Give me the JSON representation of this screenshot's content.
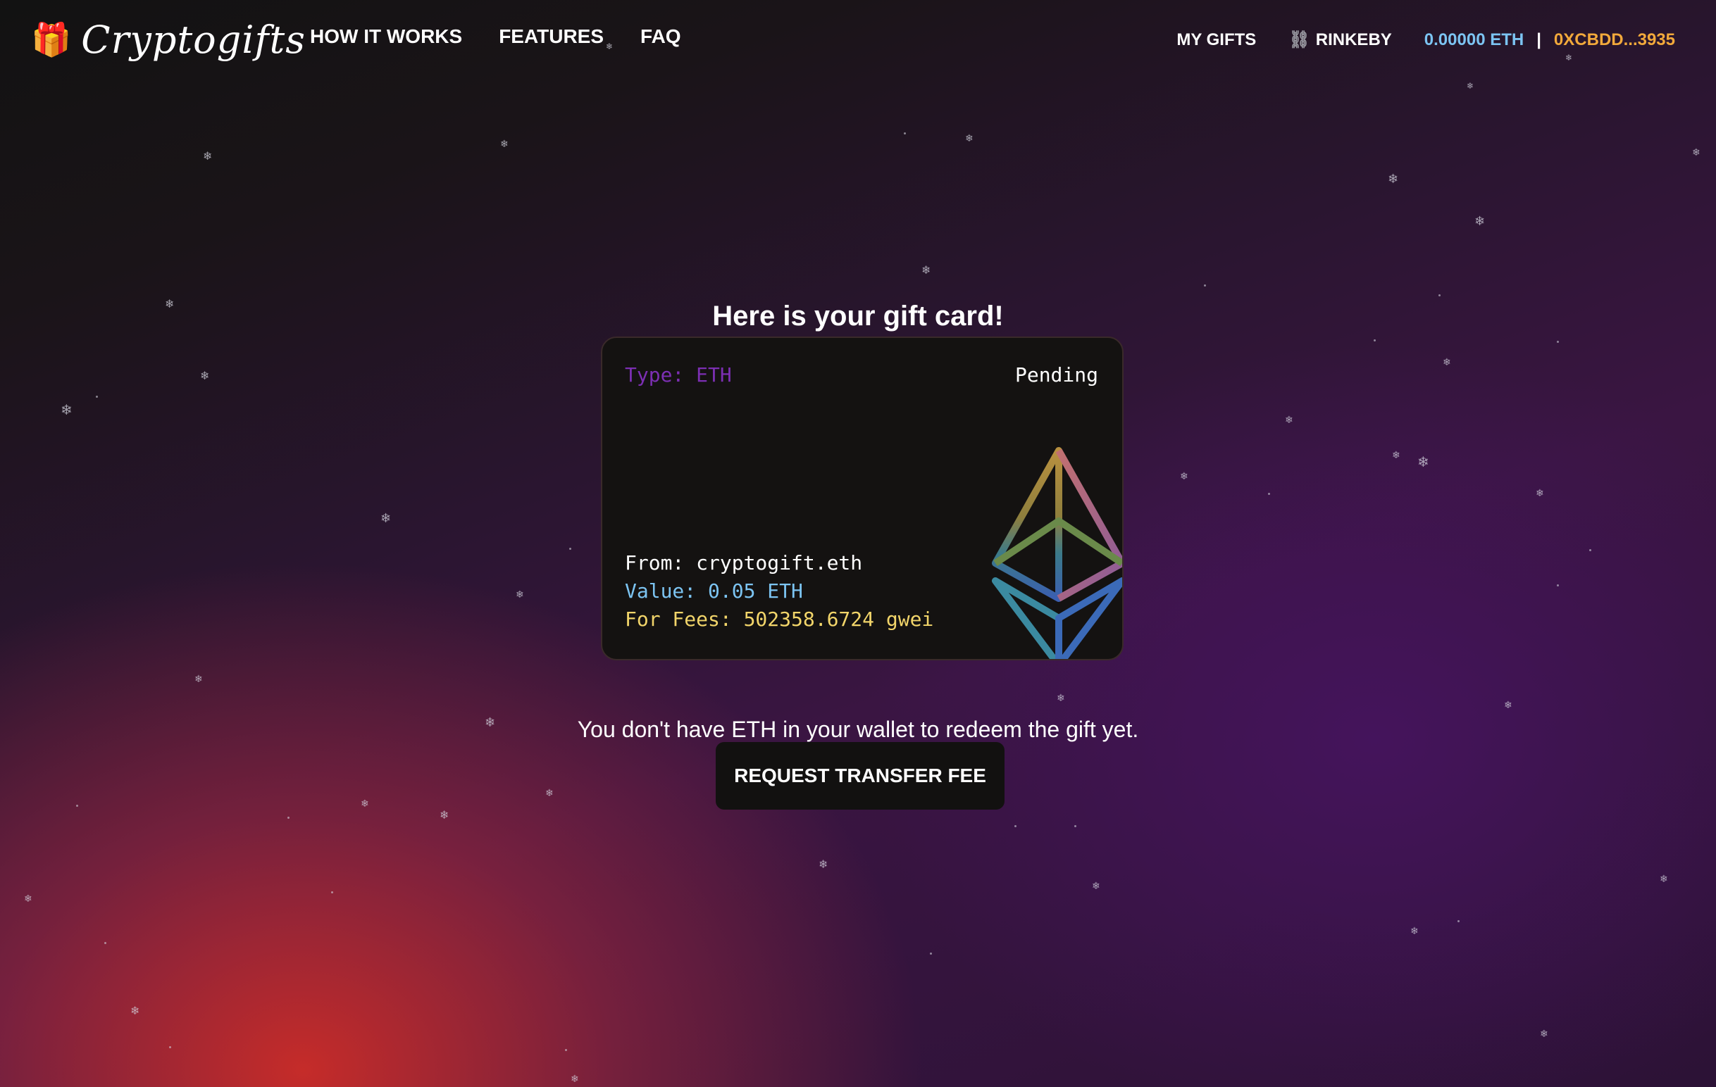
{
  "header": {
    "logo_icon": "🎁",
    "logo_text": "Cryptogifts",
    "nav": [
      {
        "label": "HOW IT WORKS"
      },
      {
        "label": "FEATURES"
      },
      {
        "label": "FAQ"
      }
    ],
    "my_gifts_label": "MY GIFTS",
    "network_icon": "⛓",
    "network_label": "RINKEBY",
    "balance": "0.00000 ETH",
    "separator": "|",
    "address": "0XCBDD...3935"
  },
  "main": {
    "heading": "Here is your gift card!",
    "card": {
      "type_label": "Type: ETH",
      "status": "Pending",
      "from": "From: cryptogift.eth",
      "value": "Value: 0.05 ETH",
      "fees": "For Fees: 502358.6724 gwei",
      "logo_icon": "ethereum-icon"
    },
    "notice": "You don't have ETH in your wallet to redeem the gift yet.",
    "cta_label": "REQUEST TRANSFER FEE"
  },
  "colors": {
    "type": "#7c2fb3",
    "value": "#7cc4f2",
    "fees": "#f2d56a",
    "balance": "#7cc4f2",
    "address": "#f2a93b",
    "card_bg": "#141211"
  }
}
